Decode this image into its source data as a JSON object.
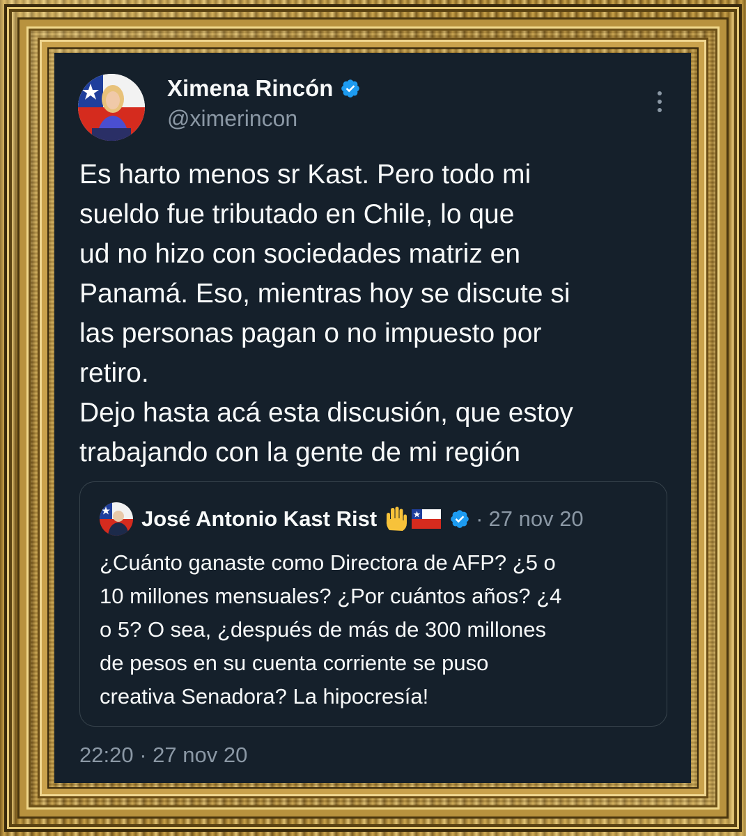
{
  "tweet": {
    "author": {
      "display_name": "Ximena Rincón",
      "handle": "@ximerincon",
      "verified": true
    },
    "text": "Es harto menos sr Kast. Pero todo mi\nsueldo fue tributado en Chile, lo que\nud no hizo con sociedades matriz en\nPanamá. Eso, mientras hoy se discute si\nlas personas pagan o no impuesto por\nretiro.\nDejo hasta acá esta discusión, que estoy\ntrabajando con la gente de mi región",
    "time": "22:20",
    "separator": "·",
    "date": "27 nov 20",
    "more_icon": "more-vertical-icon"
  },
  "quoted_tweet": {
    "author": {
      "display_name": "José Antonio Kast Rist",
      "emojis": [
        "raised-hand-icon",
        "chile-flag-icon"
      ],
      "verified": true
    },
    "separator": "·",
    "date": "27 nov 20",
    "text": "¿Cuánto ganaste como Directora de AFP? ¿5 o\n10 millones mensuales? ¿Por cuántos años? ¿4\no 5? O sea, ¿después de más de 300 millones\nde pesos en su cuenta corriente se puso\ncreativa Senadora? La hipocresía!"
  },
  "colors": {
    "background": "#15202b",
    "text_primary": "#f7f9f9",
    "text_secondary": "#8b98a5",
    "verified_blue": "#1d9bf0",
    "border": "#38444d",
    "frame_gold": "#b8923e"
  }
}
